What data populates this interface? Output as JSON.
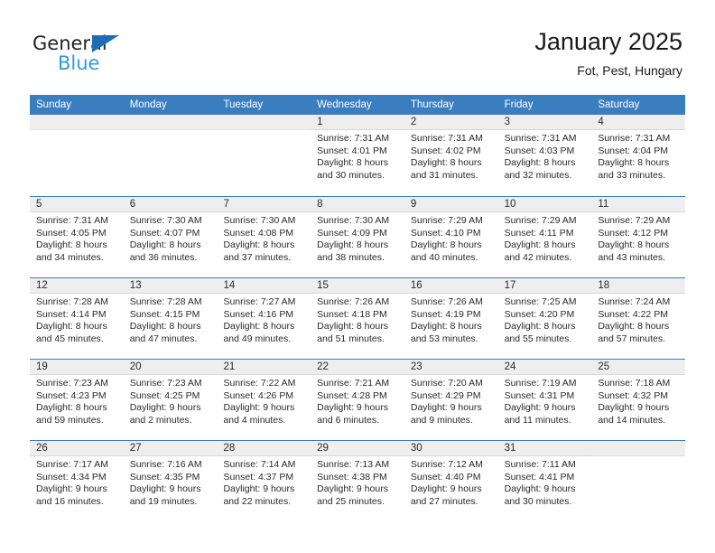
{
  "brand": {
    "name_part1": "General",
    "name_part2": "Blue",
    "triangle_color": "#1d6cb5",
    "blue_text_color": "#2e9bdf"
  },
  "header": {
    "title": "January 2025",
    "subtitle": "Fot, Pest, Hungary"
  },
  "theme": {
    "header_band": "#3a7ebf",
    "day_band": "#eeeeee",
    "text": "#2a2a2a"
  },
  "calendar": {
    "weekdays": [
      "Sunday",
      "Monday",
      "Tuesday",
      "Wednesday",
      "Thursday",
      "Friday",
      "Saturday"
    ],
    "weeks": [
      [
        {
          "day": "",
          "lines": []
        },
        {
          "day": "",
          "lines": []
        },
        {
          "day": "",
          "lines": []
        },
        {
          "day": "1",
          "lines": [
            "Sunrise: 7:31 AM",
            "Sunset: 4:01 PM",
            "Daylight: 8 hours",
            "and 30 minutes."
          ]
        },
        {
          "day": "2",
          "lines": [
            "Sunrise: 7:31 AM",
            "Sunset: 4:02 PM",
            "Daylight: 8 hours",
            "and 31 minutes."
          ]
        },
        {
          "day": "3",
          "lines": [
            "Sunrise: 7:31 AM",
            "Sunset: 4:03 PM",
            "Daylight: 8 hours",
            "and 32 minutes."
          ]
        },
        {
          "day": "4",
          "lines": [
            "Sunrise: 7:31 AM",
            "Sunset: 4:04 PM",
            "Daylight: 8 hours",
            "and 33 minutes."
          ]
        }
      ],
      [
        {
          "day": "5",
          "lines": [
            "Sunrise: 7:31 AM",
            "Sunset: 4:05 PM",
            "Daylight: 8 hours",
            "and 34 minutes."
          ]
        },
        {
          "day": "6",
          "lines": [
            "Sunrise: 7:30 AM",
            "Sunset: 4:07 PM",
            "Daylight: 8 hours",
            "and 36 minutes."
          ]
        },
        {
          "day": "7",
          "lines": [
            "Sunrise: 7:30 AM",
            "Sunset: 4:08 PM",
            "Daylight: 8 hours",
            "and 37 minutes."
          ]
        },
        {
          "day": "8",
          "lines": [
            "Sunrise: 7:30 AM",
            "Sunset: 4:09 PM",
            "Daylight: 8 hours",
            "and 38 minutes."
          ]
        },
        {
          "day": "9",
          "lines": [
            "Sunrise: 7:29 AM",
            "Sunset: 4:10 PM",
            "Daylight: 8 hours",
            "and 40 minutes."
          ]
        },
        {
          "day": "10",
          "lines": [
            "Sunrise: 7:29 AM",
            "Sunset: 4:11 PM",
            "Daylight: 8 hours",
            "and 42 minutes."
          ]
        },
        {
          "day": "11",
          "lines": [
            "Sunrise: 7:29 AM",
            "Sunset: 4:12 PM",
            "Daylight: 8 hours",
            "and 43 minutes."
          ]
        }
      ],
      [
        {
          "day": "12",
          "lines": [
            "Sunrise: 7:28 AM",
            "Sunset: 4:14 PM",
            "Daylight: 8 hours",
            "and 45 minutes."
          ]
        },
        {
          "day": "13",
          "lines": [
            "Sunrise: 7:28 AM",
            "Sunset: 4:15 PM",
            "Daylight: 8 hours",
            "and 47 minutes."
          ]
        },
        {
          "day": "14",
          "lines": [
            "Sunrise: 7:27 AM",
            "Sunset: 4:16 PM",
            "Daylight: 8 hours",
            "and 49 minutes."
          ]
        },
        {
          "day": "15",
          "lines": [
            "Sunrise: 7:26 AM",
            "Sunset: 4:18 PM",
            "Daylight: 8 hours",
            "and 51 minutes."
          ]
        },
        {
          "day": "16",
          "lines": [
            "Sunrise: 7:26 AM",
            "Sunset: 4:19 PM",
            "Daylight: 8 hours",
            "and 53 minutes."
          ]
        },
        {
          "day": "17",
          "lines": [
            "Sunrise: 7:25 AM",
            "Sunset: 4:20 PM",
            "Daylight: 8 hours",
            "and 55 minutes."
          ]
        },
        {
          "day": "18",
          "lines": [
            "Sunrise: 7:24 AM",
            "Sunset: 4:22 PM",
            "Daylight: 8 hours",
            "and 57 minutes."
          ]
        }
      ],
      [
        {
          "day": "19",
          "lines": [
            "Sunrise: 7:23 AM",
            "Sunset: 4:23 PM",
            "Daylight: 8 hours",
            "and 59 minutes."
          ]
        },
        {
          "day": "20",
          "lines": [
            "Sunrise: 7:23 AM",
            "Sunset: 4:25 PM",
            "Daylight: 9 hours",
            "and 2 minutes."
          ]
        },
        {
          "day": "21",
          "lines": [
            "Sunrise: 7:22 AM",
            "Sunset: 4:26 PM",
            "Daylight: 9 hours",
            "and 4 minutes."
          ]
        },
        {
          "day": "22",
          "lines": [
            "Sunrise: 7:21 AM",
            "Sunset: 4:28 PM",
            "Daylight: 9 hours",
            "and 6 minutes."
          ]
        },
        {
          "day": "23",
          "lines": [
            "Sunrise: 7:20 AM",
            "Sunset: 4:29 PM",
            "Daylight: 9 hours",
            "and 9 minutes."
          ]
        },
        {
          "day": "24",
          "lines": [
            "Sunrise: 7:19 AM",
            "Sunset: 4:31 PM",
            "Daylight: 9 hours",
            "and 11 minutes."
          ]
        },
        {
          "day": "25",
          "lines": [
            "Sunrise: 7:18 AM",
            "Sunset: 4:32 PM",
            "Daylight: 9 hours",
            "and 14 minutes."
          ]
        }
      ],
      [
        {
          "day": "26",
          "lines": [
            "Sunrise: 7:17 AM",
            "Sunset: 4:34 PM",
            "Daylight: 9 hours",
            "and 16 minutes."
          ]
        },
        {
          "day": "27",
          "lines": [
            "Sunrise: 7:16 AM",
            "Sunset: 4:35 PM",
            "Daylight: 9 hours",
            "and 19 minutes."
          ]
        },
        {
          "day": "28",
          "lines": [
            "Sunrise: 7:14 AM",
            "Sunset: 4:37 PM",
            "Daylight: 9 hours",
            "and 22 minutes."
          ]
        },
        {
          "day": "29",
          "lines": [
            "Sunrise: 7:13 AM",
            "Sunset: 4:38 PM",
            "Daylight: 9 hours",
            "and 25 minutes."
          ]
        },
        {
          "day": "30",
          "lines": [
            "Sunrise: 7:12 AM",
            "Sunset: 4:40 PM",
            "Daylight: 9 hours",
            "and 27 minutes."
          ]
        },
        {
          "day": "31",
          "lines": [
            "Sunrise: 7:11 AM",
            "Sunset: 4:41 PM",
            "Daylight: 9 hours",
            "and 30 minutes."
          ]
        },
        {
          "day": "",
          "lines": []
        }
      ]
    ]
  }
}
